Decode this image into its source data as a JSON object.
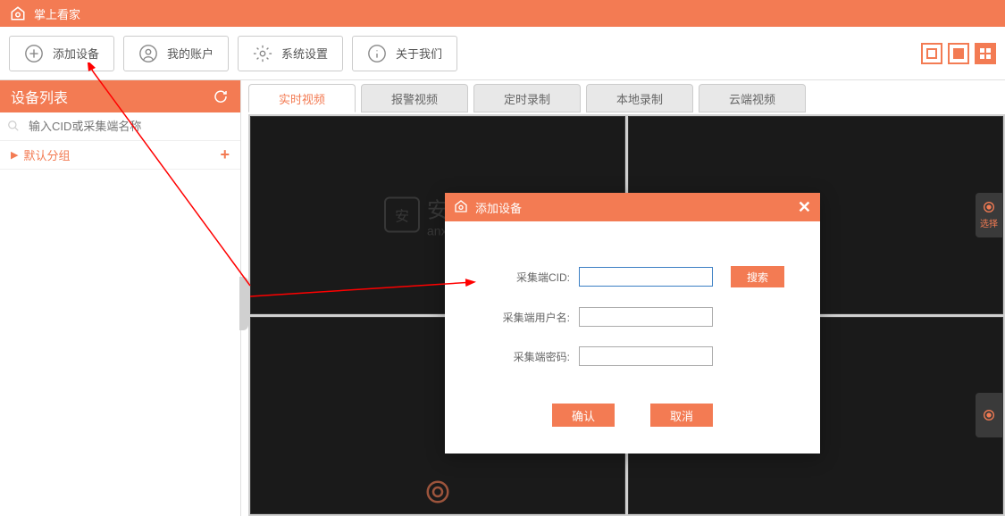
{
  "titlebar": {
    "app_name": "掌上看家"
  },
  "toolbar": {
    "add_device": "添加设备",
    "my_account": "我的账户",
    "system_settings": "系统设置",
    "about_us": "关于我们"
  },
  "sidebar": {
    "title": "设备列表",
    "search_placeholder": "输入CID或采集端名称",
    "default_group": "默认分组"
  },
  "tabs": [
    {
      "label": "实时视频",
      "active": true
    },
    {
      "label": "报警视频",
      "active": false
    },
    {
      "label": "定时录制",
      "active": false
    },
    {
      "label": "本地录制",
      "active": false
    },
    {
      "label": "云端视频",
      "active": false
    }
  ],
  "watermark": {
    "text1": "安下载",
    "text2": "anxz.com",
    "badge": "安"
  },
  "select_badge": "选择",
  "dialog": {
    "title": "添加设备",
    "field_cid": "采集端CID:",
    "field_user": "采集端用户名:",
    "field_pwd": "采集端密码:",
    "btn_search": "搜索",
    "btn_ok": "确认",
    "btn_cancel": "取消"
  }
}
